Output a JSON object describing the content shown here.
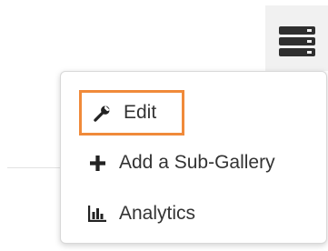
{
  "menu": {
    "items": [
      {
        "label": "Edit",
        "icon": "wrench-icon",
        "highlighted": true,
        "highlight_color": "#f08a3a"
      },
      {
        "label": "Add a Sub-Gallery",
        "icon": "plus-icon"
      },
      {
        "label": "Analytics",
        "icon": "bar-chart-icon"
      }
    ]
  },
  "toggle": {
    "icon": "server-stack-icon",
    "background": "#f1f1f1",
    "icon_color": "#2f2f2f"
  }
}
